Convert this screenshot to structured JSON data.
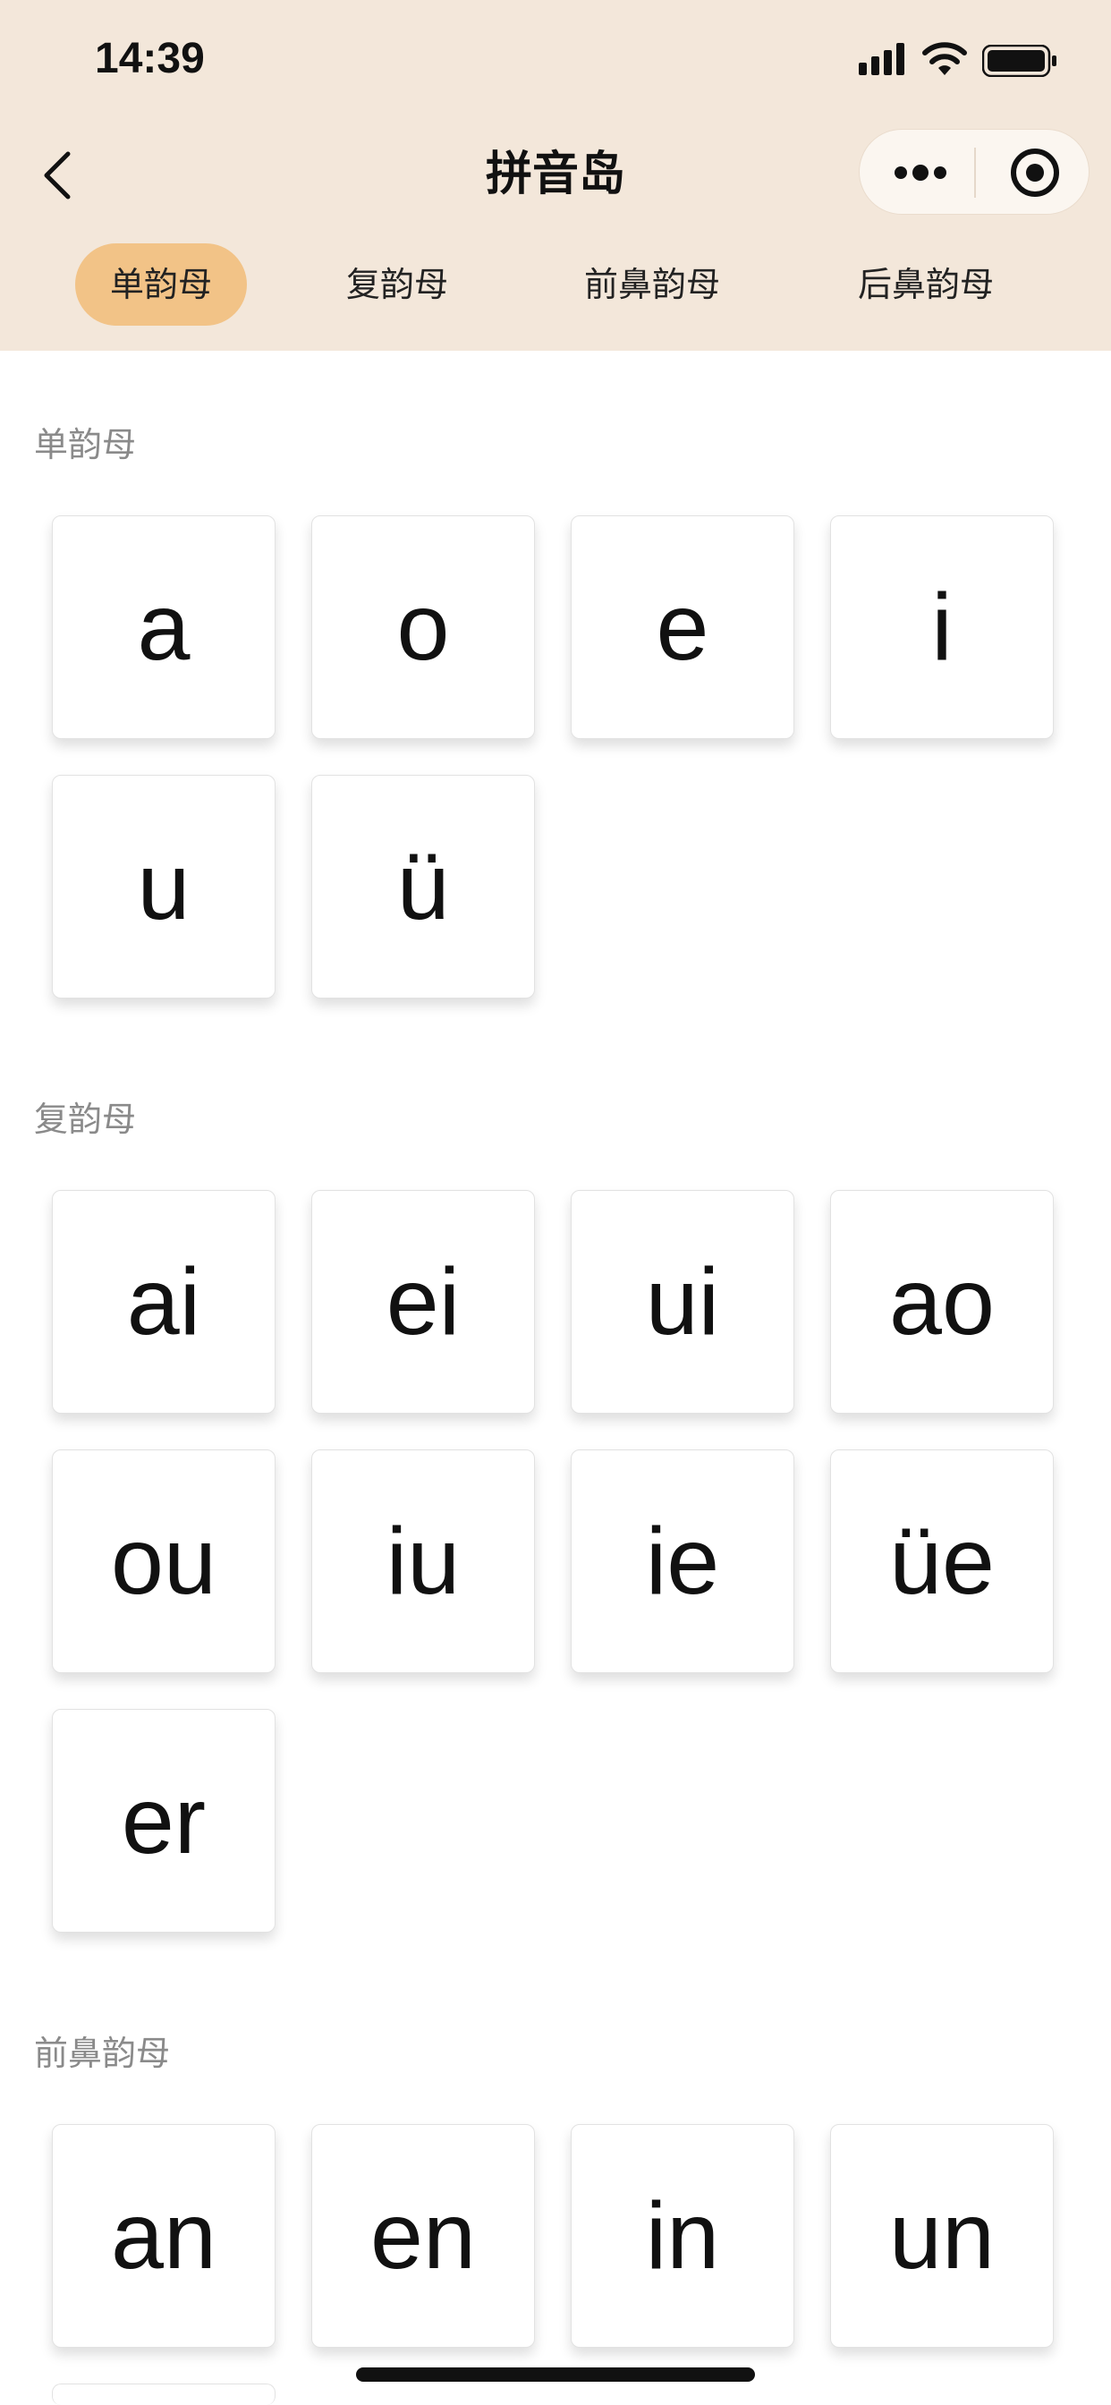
{
  "status_bar": {
    "time": "14:39"
  },
  "nav": {
    "title": "拼音岛"
  },
  "tabs": [
    {
      "label": "单韵母",
      "active": true
    },
    {
      "label": "复韵母",
      "active": false
    },
    {
      "label": "前鼻韵母",
      "active": false
    },
    {
      "label": "后鼻韵母",
      "active": false
    }
  ],
  "sections": [
    {
      "title": "单韵母",
      "items": [
        "a",
        "o",
        "e",
        "i",
        "u",
        "ü"
      ]
    },
    {
      "title": "复韵母",
      "items": [
        "ai",
        "ei",
        "ui",
        "ao",
        "ou",
        "iu",
        "ie",
        "üe",
        "er"
      ]
    },
    {
      "title": "前鼻韵母",
      "items": [
        "an",
        "en",
        "in",
        "un"
      ]
    }
  ],
  "colors": {
    "header_bg": "#f3e7da",
    "active_tab": "#f2c387"
  }
}
